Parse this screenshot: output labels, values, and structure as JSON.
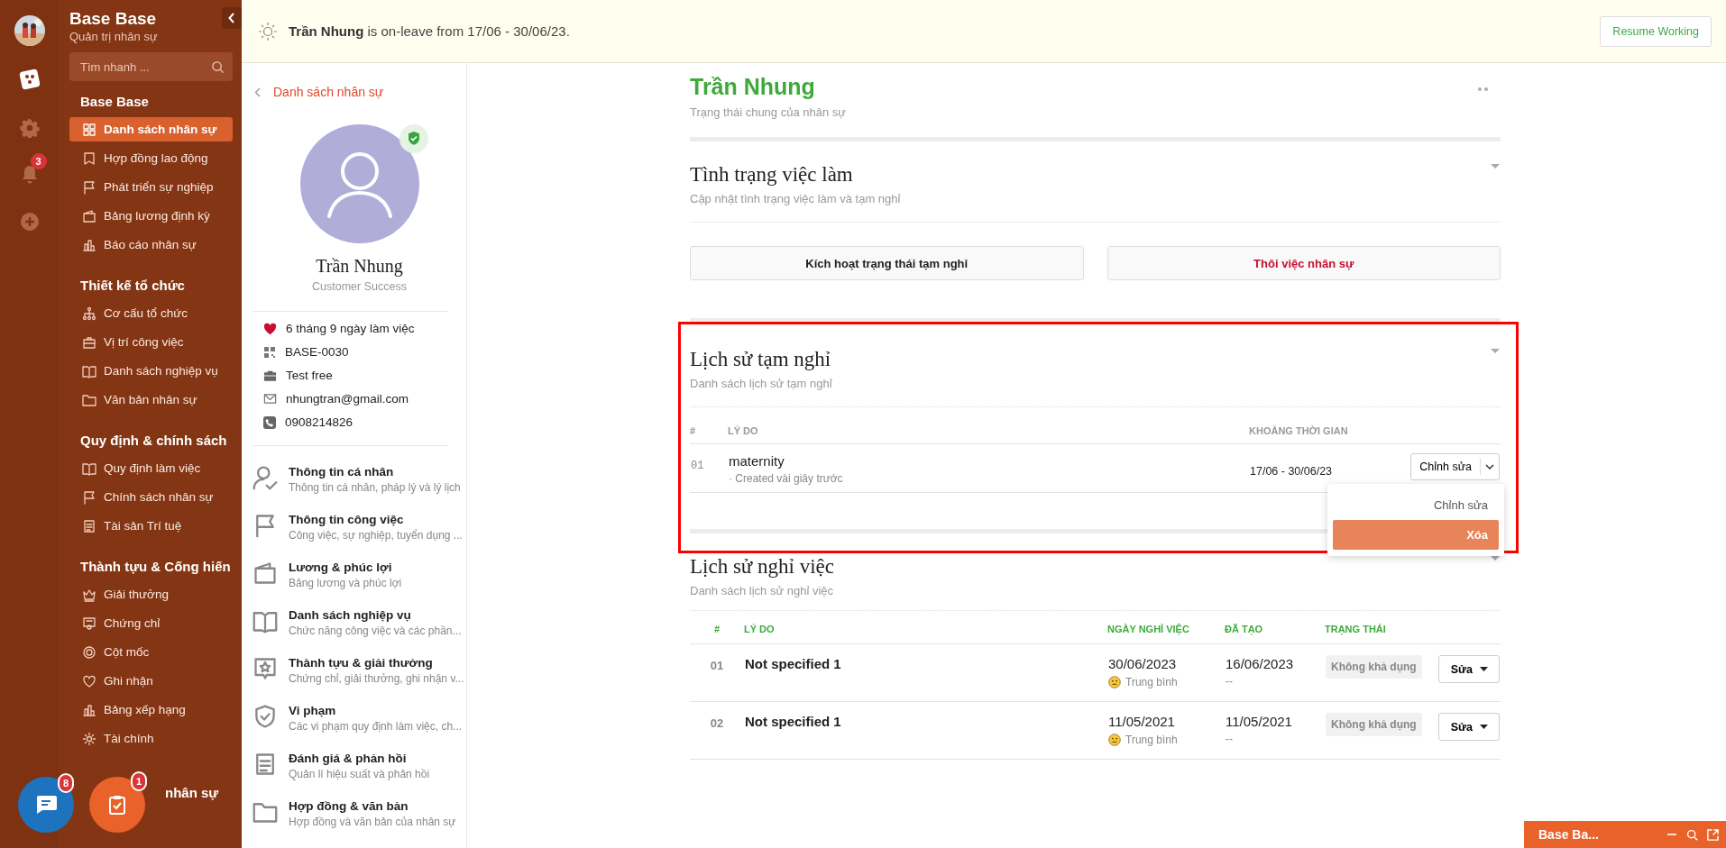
{
  "rail": {
    "notification_count": "3"
  },
  "sidebar": {
    "title": "Base Base",
    "subtitle": "Quản trị nhân sự",
    "search_placeholder": "Tìm nhanh ...",
    "groups": [
      {
        "title": "Base Base",
        "items": [
          {
            "label": "Danh sách nhân sự",
            "selected": true
          },
          {
            "label": "Hợp đồng lao động",
            "selected": false
          },
          {
            "label": "Phát triển sự nghiệp",
            "selected": false
          },
          {
            "label": "Bảng lương định kỳ",
            "selected": false
          },
          {
            "label": "Báo cáo nhân sự",
            "selected": false
          }
        ]
      },
      {
        "title": "Thiết kế tổ chức",
        "items": [
          {
            "label": "Cơ cấu tổ chức",
            "selected": false
          },
          {
            "label": "Vị trí công việc",
            "selected": false
          },
          {
            "label": "Danh sách nghiệp vụ",
            "selected": false
          },
          {
            "label": "Văn bản nhân sự",
            "selected": false
          }
        ]
      },
      {
        "title": "Quy định & chính sách",
        "items": [
          {
            "label": "Quy định làm việc",
            "selected": false
          },
          {
            "label": "Chính sách nhân sự",
            "selected": false
          },
          {
            "label": "Tài sản Trí tuệ",
            "selected": false
          }
        ]
      },
      {
        "title": "Thành tựu & Cống hiến",
        "items": [
          {
            "label": "Giải thưởng",
            "selected": false
          },
          {
            "label": "Chứng chỉ",
            "selected": false
          },
          {
            "label": "Cột mốc",
            "selected": false
          },
          {
            "label": "Ghi nhận",
            "selected": false
          },
          {
            "label": "Bảng xếp hạng",
            "selected": false
          },
          {
            "label": "Tài chính",
            "selected": false
          }
        ]
      },
      {
        "title": "nhân sự",
        "kind": "covered"
      }
    ]
  },
  "banner": {
    "message": "**Trần Nhung** is on-leave from 17/06 - 30/06/23.",
    "button": "Resume Working"
  },
  "profile": {
    "back_link": "Danh sách nhân sự",
    "verified": true,
    "name": "Trần Nhung",
    "role": "Customer Success",
    "info": [
      "6 tháng 9 ngày làm việc",
      "BASE-0030",
      "Test free",
      "nhungtran@gmail.com",
      "0908214826"
    ],
    "menu": [
      {
        "title": "Thông tin cá nhân",
        "description": "Thông tin cá nhân, pháp lý và lý lịch"
      },
      {
        "title": "Thông tin công việc",
        "description": "Công việc, sự nghiệp, tuyển dụng ..."
      },
      {
        "title": "Lương & phúc lợi",
        "description": "Bảng lương và phúc lợi"
      },
      {
        "title": "Danh sách nghiệp vụ",
        "description": "Chức năng công việc và các phần..."
      },
      {
        "title": "Thành tựu & giải thưởng",
        "description": "Chứng chỉ, giải thưởng, ghi nhận v..."
      },
      {
        "title": "Vi phạm",
        "description": "Các vi phạm quy định làm việc, ch..."
      },
      {
        "title": "Đánh giá & phản hồi",
        "description": "Quản lí hiệu suất và phản hồi"
      },
      {
        "title": "Hợp đồng & văn bản",
        "description": "Hợp đồng và văn bản của nhân sự"
      }
    ]
  },
  "main": {
    "title": "Trần Nhung",
    "subtitle": "Trạng thái chung của nhân sự",
    "employment": {
      "title": "Tình trạng việc làm",
      "subtitle": "Cập nhật tình trạng việc làm và tạm nghỉ",
      "buttons": [
        {
          "label": "Kích hoạt trạng thái tạm nghỉ",
          "kind": "neutral"
        },
        {
          "label": "Thôi việc nhân sự",
          "kind": "danger"
        }
      ]
    },
    "leave_history": {
      "title": "Lịch sử tạm nghỉ",
      "subtitle": "Danh sách lịch sử tạm nghỉ",
      "columns": [
        "#",
        "LÝ DO",
        "KHOẢNG THỜI GIAN"
      ],
      "rows": [
        {
          "number": "01",
          "reason": "maternity",
          "note": "· Created vài giây trước",
          "period": "17/06 - 30/06/23",
          "action": "Chỉnh sửa"
        }
      ],
      "menu": [
        {
          "label": "Chỉnh sửa",
          "selected": false
        },
        {
          "label": "Xóa",
          "selected": true
        }
      ]
    },
    "resign_history": {
      "title": "Lịch sử nghỉ việc",
      "subtitle": "Danh sách lịch sử nghỉ việc",
      "columns": [
        "#",
        "LÝ DO",
        "NGÀY NGHỈ VIỆC",
        "ĐÃ TẠO",
        "TRẠNG THÁI"
      ],
      "rows": [
        {
          "number": "01",
          "reason": "Not specified 1",
          "date": "30/06/2023",
          "rating": "Trung bình",
          "created": "16/06/2023",
          "created_note": "--",
          "status": "Không khả dụng",
          "action": "Sửa"
        },
        {
          "number": "02",
          "reason": "Not specified 1",
          "date": "11/05/2021",
          "rating": "Trung bình",
          "created": "11/05/2021",
          "created_note": "--",
          "status": "Không khả dụng",
          "action": "Sửa"
        }
      ]
    }
  },
  "floating": {
    "chat_count": "8",
    "task_count": "1"
  },
  "minibar": {
    "title": "Base Ba..."
  }
}
